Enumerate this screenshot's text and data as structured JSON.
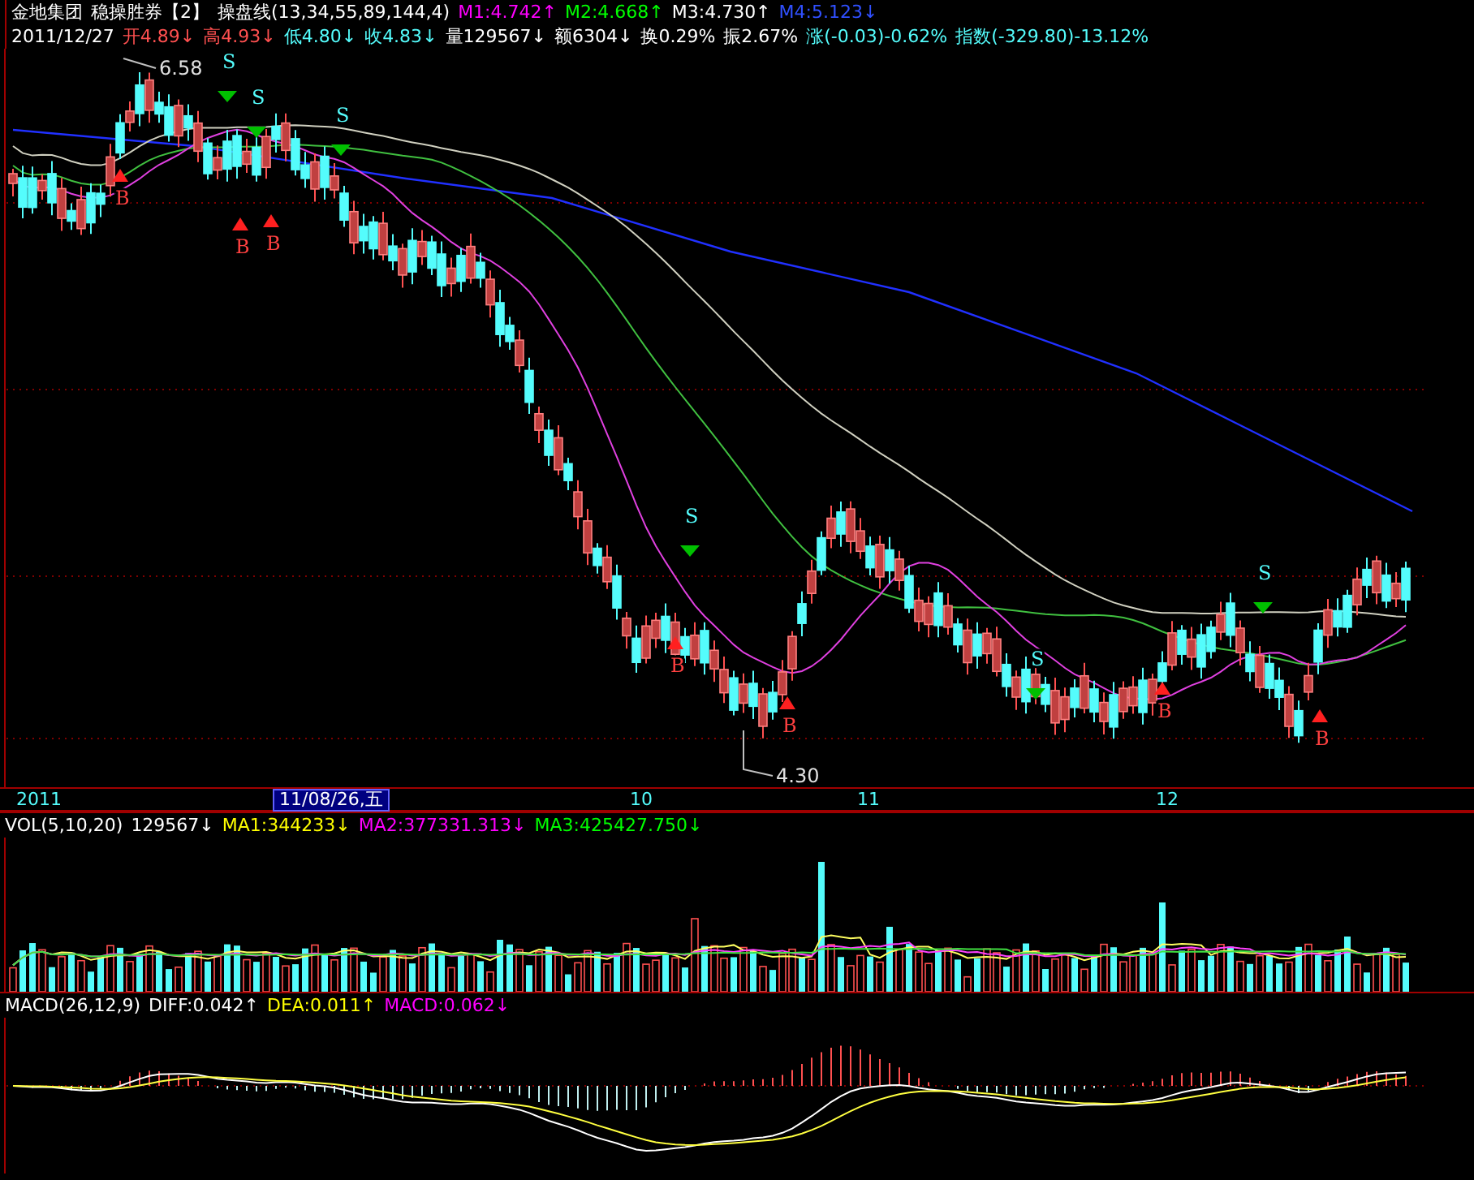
{
  "header": {
    "stock_name": "金地集团",
    "system_name": "稳操胜券【2】",
    "indicator": "操盘线(13,34,55,89,144,4)",
    "lines": [
      {
        "label": "M1:4.742",
        "arrow": "↑",
        "color": "#ff00ff"
      },
      {
        "label": "M2:4.668",
        "arrow": "↑",
        "color": "#00ff00"
      },
      {
        "label": "M3:4.730",
        "arrow": "↑",
        "color": "#ffffff"
      },
      {
        "label": "M4:5.123",
        "arrow": "↓",
        "color": "#3050ff"
      }
    ]
  },
  "quote": {
    "date": "2011/12/27",
    "items": [
      {
        "label": "开4.89",
        "arrow": "↓",
        "color": "#ff5050"
      },
      {
        "label": "高4.93",
        "arrow": "↓",
        "color": "#ff5050"
      },
      {
        "label": "低4.80",
        "arrow": "↓",
        "color": "#54fcfc"
      },
      {
        "label": "收4.83",
        "arrow": "↓",
        "color": "#54fcfc"
      },
      {
        "label": "量129567",
        "arrow": "↓",
        "color": "#ffffff"
      },
      {
        "label": "额6304",
        "arrow": "↓",
        "color": "#ffffff"
      },
      {
        "label": "换0.29%",
        "color": "#ffffff"
      },
      {
        "label": "振2.67%",
        "color": "#ffffff"
      },
      {
        "label": "涨(-0.03)-0.62%",
        "color": "#54fcfc"
      },
      {
        "label": "指数(-329.80)-13.12%",
        "color": "#54fcfc"
      }
    ]
  },
  "price_chart": {
    "high_label": "6.58",
    "low_label": "4.30",
    "signals": [
      {
        "kind": "buy",
        "text": "B"
      },
      {
        "kind": "sell",
        "text": "S"
      },
      {
        "kind": "buy",
        "text": "B"
      },
      {
        "kind": "sell",
        "text": "S"
      },
      {
        "kind": "buy",
        "text": "B"
      },
      {
        "kind": "sell",
        "text": "S"
      },
      {
        "kind": "buy",
        "text": "B"
      },
      {
        "kind": "sell",
        "text": "S"
      },
      {
        "kind": "buy",
        "text": "B"
      },
      {
        "kind": "sell",
        "text": "S"
      },
      {
        "kind": "buy",
        "text": "B"
      },
      {
        "kind": "sell",
        "text": "S"
      },
      {
        "kind": "buy",
        "text": "B"
      }
    ]
  },
  "time_axis": {
    "labels": [
      "2011",
      "10",
      "11",
      "12"
    ],
    "cursor_date": "11/08/26,五"
  },
  "volume": {
    "title": "VOL(5,10,20)",
    "value": "129567",
    "arrow": "↓",
    "lines": [
      {
        "label": "MA1:344233",
        "arrow": "↓",
        "color": "#ffff00"
      },
      {
        "label": "MA2:377331.313",
        "arrow": "↓",
        "color": "#ff00ff"
      },
      {
        "label": "MA3:425427.750",
        "arrow": "↓",
        "color": "#00ff00"
      }
    ]
  },
  "macd": {
    "title": "MACD(26,12,9)",
    "lines": [
      {
        "label": "DIFF:0.042",
        "arrow": "↑",
        "color": "#ffffff"
      },
      {
        "label": "DEA:0.011",
        "arrow": "↑",
        "color": "#ffff00"
      },
      {
        "label": "MACD:0.062",
        "arrow": "↓",
        "color": "#ff00ff"
      }
    ]
  }
}
